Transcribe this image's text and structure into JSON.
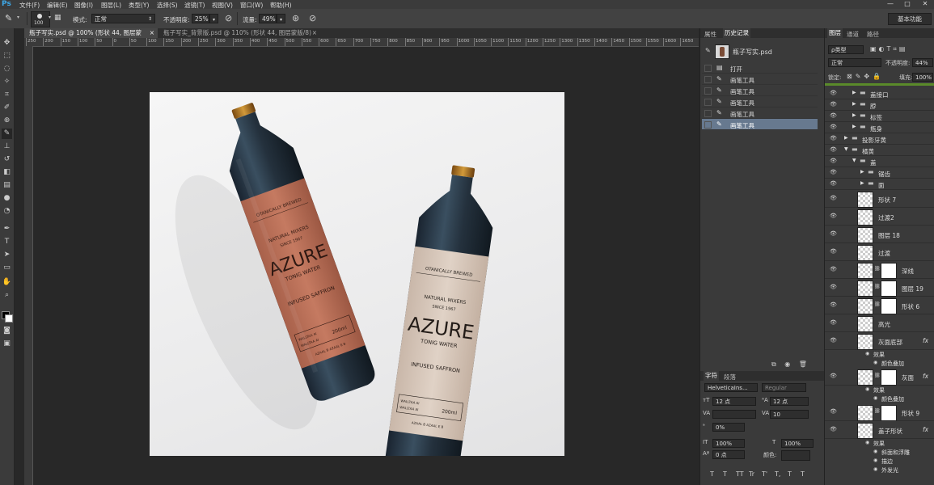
{
  "app": {
    "logo": "Ps"
  },
  "menu": [
    "文件(F)",
    "编辑(E)",
    "图像(I)",
    "图层(L)",
    "类型(Y)",
    "选择(S)",
    "滤镜(T)",
    "视图(V)",
    "窗口(W)",
    "帮助(H)"
  ],
  "window_controls": [
    "—",
    "□",
    "✕"
  ],
  "options": {
    "brush_size": "100",
    "mode_label": "模式:",
    "mode_value": "正常",
    "opacity_label": "不透明度:",
    "opacity_value": "25%",
    "flow_label": "流量:",
    "flow_value": "49%",
    "workspace": "基本功能"
  },
  "tabs": [
    {
      "label": "瓶子写实.psd @ 100% (形状 44, 图层蒙版/8) *",
      "close": "×",
      "active": true
    },
    {
      "label": "瓶子写实_背景版.psd @ 110% (形状 44, 图层蒙版/8) *",
      "close": "×",
      "active": false
    }
  ],
  "ruler_h": [
    "250",
    "200",
    "150",
    "100",
    "50",
    "0",
    "50",
    "100",
    "150",
    "200",
    "250",
    "300",
    "350",
    "400",
    "450",
    "500",
    "550",
    "600",
    "650",
    "700",
    "750",
    "800",
    "850",
    "900",
    "950",
    "1000",
    "1050",
    "1100",
    "1150",
    "1200",
    "1250",
    "1300",
    "1350",
    "1400",
    "1450",
    "1500",
    "1550",
    "1600",
    "1650"
  ],
  "bottle_labels": {
    "brewed": "OTANICALLY BREWED",
    "mixers": "NATURAL MIXERS",
    "since": "SINCE 1967",
    "brand": "AZURE",
    "tonic": "TONIG WATER",
    "infused": "INFUSED SAFFRON",
    "volume": "200ml",
    "code1": "WALLTAA AI",
    "code2": "WALLTAA AI",
    "footer": "AZAAL B AZAAL E B"
  },
  "history": {
    "tabs": [
      "属性",
      "历史记录"
    ],
    "snapshot": "瓶子写实.psd",
    "items": [
      {
        "label": "打开",
        "selected": false
      },
      {
        "label": "画笔工具",
        "selected": false
      },
      {
        "label": "画笔工具",
        "selected": false
      },
      {
        "label": "画笔工具",
        "selected": false
      },
      {
        "label": "画笔工具",
        "selected": false
      },
      {
        "label": "画笔工具",
        "selected": true
      }
    ]
  },
  "character": {
    "tabs": [
      "字符",
      "段落"
    ],
    "font_family": "HelveticaIns...",
    "font_style": "Regular",
    "font_size": "12 点",
    "leading": "12 点",
    "tracking": "10",
    "baseline_pct": "0%",
    "vscale": "100%",
    "hscale": "100%",
    "shift": "0 点",
    "color_label": "颜色:",
    "style_buttons": [
      "T",
      "T",
      "TT",
      "Tr",
      "T'",
      "T,",
      "T",
      "T"
    ]
  },
  "layers": {
    "tabs": [
      "图层",
      "通道",
      "路径"
    ],
    "filter": "ρ类型",
    "blend": "正常",
    "opacity_label": "不透明度:",
    "opacity": "44%",
    "lock_label": "锁定:",
    "fill_label": "填充:",
    "fill": "100%",
    "rows": [
      {
        "label": "盖接口",
        "type": "folder",
        "indent": 2,
        "expanded": false
      },
      {
        "label": "脖",
        "type": "folder",
        "indent": 2,
        "expanded": false
      },
      {
        "label": "标签",
        "type": "folder",
        "indent": 2,
        "expanded": false
      },
      {
        "label": "瓶身",
        "type": "folder",
        "indent": 2,
        "expanded": false
      },
      {
        "label": "投影牙黄",
        "type": "folder",
        "indent": 1,
        "expanded": false
      },
      {
        "label": "橘黄",
        "type": "folder",
        "indent": 1,
        "expanded": true
      },
      {
        "label": "盖",
        "type": "folder",
        "indent": 2,
        "expanded": true
      },
      {
        "label": "锯齿",
        "type": "folder",
        "indent": 3,
        "expanded": false
      },
      {
        "label": "面",
        "type": "folder",
        "indent": 3,
        "expanded": false
      },
      {
        "label": "形状 7",
        "type": "layer",
        "mask": false,
        "fx": false
      },
      {
        "label": "过渡2",
        "type": "layer",
        "mask": false,
        "fx": false
      },
      {
        "label": "图层 18",
        "type": "layer",
        "mask": false,
        "fx": false
      },
      {
        "label": "过渡",
        "type": "layer",
        "mask": false,
        "fx": false
      },
      {
        "label": "深线",
        "type": "layer",
        "mask": true,
        "fx": false
      },
      {
        "label": "图层 19",
        "type": "layer",
        "mask": true,
        "fx": false
      },
      {
        "label": "形状 6",
        "type": "layer",
        "mask": true,
        "fx": false
      },
      {
        "label": "高光",
        "type": "layer",
        "mask": false,
        "fx": false
      },
      {
        "label": "灰面底部",
        "type": "layer",
        "mask": false,
        "fx": true
      },
      {
        "label": "效果",
        "type": "effect-head"
      },
      {
        "label": "颜色叠加",
        "type": "effect"
      },
      {
        "label": "灰面",
        "type": "layer",
        "mask": true,
        "fx": true
      },
      {
        "label": "效果",
        "type": "effect-head"
      },
      {
        "label": "颜色叠加",
        "type": "effect"
      },
      {
        "label": "形状 9",
        "type": "layer",
        "mask": true,
        "fx": false
      },
      {
        "label": "盖子形状",
        "type": "layer",
        "mask": false,
        "fx": true
      },
      {
        "label": "效果",
        "type": "effect-head"
      },
      {
        "label": "斜面和浮雕",
        "type": "effect"
      },
      {
        "label": "描边",
        "type": "effect"
      },
      {
        "label": "外发光",
        "type": "effect"
      }
    ],
    "fx": "fx"
  }
}
